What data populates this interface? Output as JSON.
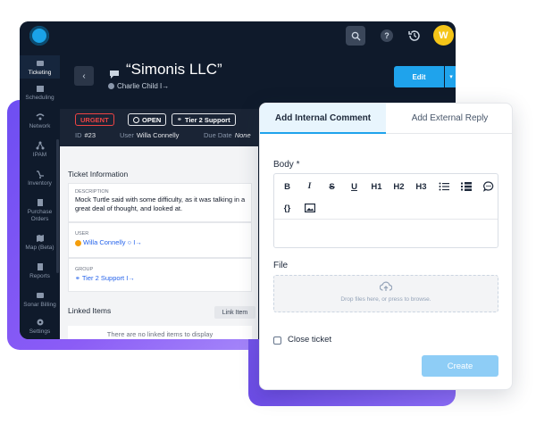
{
  "app": {
    "avatar_initial": "W",
    "help_glyph": "?"
  },
  "sidebar": {
    "items": [
      {
        "label": "Ticketing",
        "icon": "ticket-icon",
        "active": true
      },
      {
        "label": "Scheduling",
        "icon": "calendar-icon"
      },
      {
        "label": "Network",
        "icon": "network-icon"
      },
      {
        "label": "IPAM",
        "icon": "ipam-icon"
      },
      {
        "label": "Inventory",
        "icon": "inventory-icon"
      },
      {
        "label": "Purchase Orders",
        "icon": "purchase-orders-icon"
      },
      {
        "label": "Map (Beta)",
        "icon": "map-icon"
      },
      {
        "label": "Reports",
        "icon": "reports-icon"
      },
      {
        "label": "Sonar Billing",
        "icon": "billing-icon"
      },
      {
        "label": "Settings",
        "icon": "settings-icon"
      }
    ]
  },
  "ticket": {
    "back_glyph": "‹",
    "title": "“Simonis LLC”",
    "subtitle": "Charlie Child I→",
    "edit_label": "Edit",
    "edit_caret": "▾",
    "badges": {
      "priority": "URGENT",
      "status": "OPEN",
      "group": "Tier 2 Support"
    },
    "meta": {
      "id_label": "ID",
      "id_value": "#23",
      "user_label": "User",
      "user_value": "Willa Connelly",
      "due_label": "Due Date",
      "due_value": "None"
    },
    "info_title": "Ticket Information",
    "description_label": "DESCRIPTION",
    "description": "Mock Turtle said with some difficulty, as it was talking in a great deal of thought, and looked at.",
    "user_label": "USER",
    "user_value": "Willa Connelly ○ I→",
    "group_label": "GROUP",
    "group_value": "Tier 2 Support I→",
    "linked_title": "Linked Items",
    "link_items_label": "Link Item",
    "linked_empty": "There are no linked items to display"
  },
  "comment_panel": {
    "tabs": [
      "Add Internal Comment",
      "Add External Reply"
    ],
    "body_label": "Body *",
    "toolbar": [
      "B",
      "I",
      "S",
      "U",
      "H1",
      "H2",
      "H3",
      "bullet-list",
      "numbered-list",
      "comment",
      "{}",
      "image"
    ],
    "file_label": "File",
    "drop_text": "Drop files here, or press to browse.",
    "close_ticket_label": "Close ticket",
    "create_label": "Create"
  },
  "colors": {
    "app_bg": "#0f1a2b",
    "accent": "#1fa3ec",
    "urgent": "#ef4444",
    "purple": "#7c5cf4",
    "avatar": "#f5c518"
  }
}
